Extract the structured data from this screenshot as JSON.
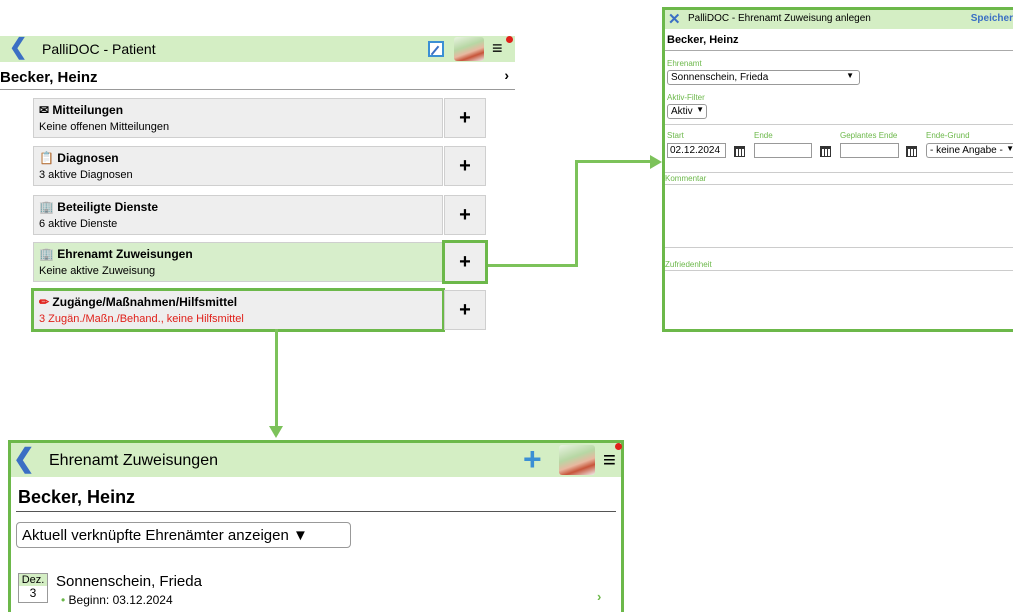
{
  "patient_view": {
    "title": "PalliDOC - Patient",
    "patient_name": "Becker, Heinz",
    "cards": [
      {
        "icon": "✉",
        "title": "Mitteilungen",
        "subtitle": "Keine offenen Mitteilungen"
      },
      {
        "icon": "📋",
        "title": "Diagnosen",
        "subtitle": "3 aktive Diagnosen"
      },
      {
        "icon": "🏢",
        "title": "Beteiligte Dienste",
        "subtitle": "6 aktive Dienste"
      },
      {
        "icon": "🏢",
        "title": "Ehrenamt Zuweisungen",
        "subtitle": "Keine aktive Zuweisung"
      },
      {
        "icon": "✏",
        "title": "Zugänge/Maßnahmen/Hilfsmittel",
        "subtitle": "3 Zugän./Maßn./Behand., keine Hilfsmittel"
      }
    ],
    "plus_label": "+"
  },
  "form_view": {
    "title": "PalliDOC - Ehrenamt Zuweisung anlegen",
    "save_label": "Speicher",
    "patient_name": "Becker, Heinz",
    "ehrenamt_label": "Ehrenamt",
    "ehrenamt_value": "Sonnenschein, Frieda",
    "filter_label": "Aktiv-Filter",
    "filter_value": "Aktiv",
    "start_label": "Start",
    "start_value": "02.12.2024",
    "ende_label": "Ende",
    "geplantes_ende_label": "Geplantes Ende",
    "ende_grund_label": "Ende-Grund",
    "ende_grund_value": "- keine Angabe -",
    "kommentar_label": "Kommentar",
    "zufriedenheit_label": "Zufriedenheit"
  },
  "list_view": {
    "title": "Ehrenamt Zuweisungen",
    "patient_name": "Becker, Heinz",
    "filter_value": "Aktuell verknüpfte Ehrenämter anzeigen",
    "entries": [
      {
        "month": "Dez.",
        "day": "3",
        "name": "Sonnenschein, Frieda",
        "detail": "Beginn: 03.12.2024"
      }
    ]
  },
  "colors": {
    "header_green": "#d4eec4",
    "highlight_green": "#6cb84a",
    "accent_blue": "#3b6fc4",
    "warning_red": "#e0201a"
  }
}
